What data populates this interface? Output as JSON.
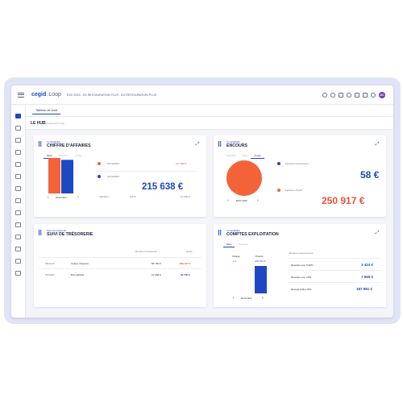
{
  "app": {
    "brand": "cegid",
    "product": "Loop",
    "tenant": "EXO 2023 - EG RESTAURATION PLUS - EG RESTAURATION PLUS",
    "avatar": "DC"
  },
  "tabs": [
    {
      "label": "Tableau de bord"
    }
  ],
  "hub": {
    "title": "LE HUB",
    "subtitle": "powered by Loop"
  },
  "colors": {
    "accent": "#1c48c4",
    "orange": "#f4623a",
    "red": "#e8523a"
  },
  "ca": {
    "category": "Comptabilité",
    "title": "CHIFFRE D'AFFAIRES",
    "pills": [
      "Mois",
      "Trimestre",
      "Année"
    ],
    "rows": [
      {
        "date": "31/12/2022",
        "amount": "227 658 €"
      },
      {
        "date": "31/12/2023",
        "amount": ""
      }
    ],
    "variation_label": "Variation",
    "variation_pct": "-9,6 %",
    "variation_val": "-",
    "total": "215 638 €",
    "total_sub": "-12 020 €",
    "month": "Décembre",
    "bars": [
      {
        "label": "2022",
        "value": 227658
      },
      {
        "label": "2023",
        "value": 215638
      }
    ]
  },
  "encours": {
    "category": "Comptabilité",
    "title": "ENCOURS",
    "pills": [
      "Semaine",
      "Mois",
      "Année"
    ],
    "rows": [
      {
        "label": "Factures fournisseurs",
        "value": "58 €"
      },
      {
        "label": "Factures clients",
        "value": "250 917 €"
      }
    ],
    "period": "EXO 2023",
    "pie": [
      {
        "label": "Factures fournisseurs",
        "value": 58
      },
      {
        "label": "Factures clients",
        "value": 250917
      }
    ]
  },
  "tresorerie": {
    "category": "Suivi de trésorerie",
    "title": "SUIVI DE TRÉSORERIE",
    "headers": [
      "Dernier mouvement",
      "Solde"
    ],
    "rows": [
      {
        "date": "28/11/23",
        "label": "Caisse d'espèce",
        "last": "86 780 €",
        "solde": "-609 197 €"
      },
      {
        "date": "30/10/23",
        "label": "Bnp paribas",
        "last": "19 668 €",
        "solde": "69 785 €"
      }
    ]
  },
  "exploitation": {
    "category": "Comptabilité",
    "title": "COMPTES EXPLOITATION",
    "pills": [
      "Mois",
      "Trimestre"
    ],
    "charge_label": "Charge",
    "produit_label": "Produit",
    "charge_value": "0 €",
    "produit_value": "215 701 €",
    "month": "Décembre",
    "headers": [
      "Derniers mouvements"
    ],
    "rows": [
      {
        "label": "Recettes ese. 5,50%",
        "value": "3 424 €"
      },
      {
        "label": "Recettes ese. 10%",
        "value": "7 569 €"
      },
      {
        "label": "Recette buffet 10%",
        "value": "187 981 €"
      }
    ],
    "bars": [
      {
        "label": "Charge",
        "value": 0
      },
      {
        "label": "Produit",
        "value": 215701
      }
    ]
  }
}
